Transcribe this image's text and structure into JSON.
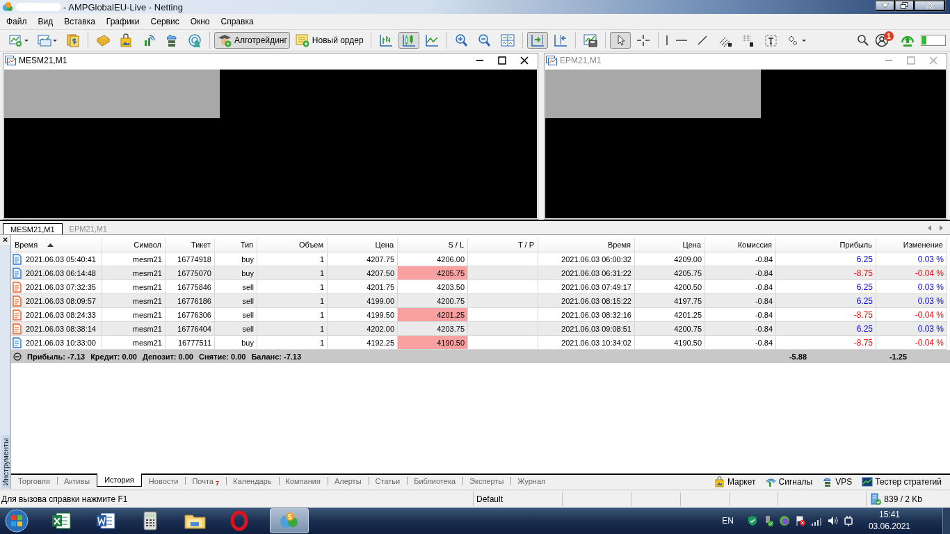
{
  "window": {
    "title": "- AMPGlobalEU-Live - Netting"
  },
  "menu": [
    "Файл",
    "Вид",
    "Вставка",
    "Графики",
    "Сервис",
    "Окно",
    "Справка"
  ],
  "toolbar": [
    {
      "kind": "icon",
      "pressed": false
    },
    {
      "kind": "icon",
      "pressed": false
    },
    {
      "kind": "icon",
      "pressed": false
    },
    {
      "kind": "separator"
    },
    {
      "kind": "icon",
      "pressed": false
    },
    {
      "kind": "icon",
      "pressed": false
    },
    {
      "kind": "icon",
      "pressed": false
    },
    {
      "kind": "icon",
      "pressed": false
    },
    {
      "kind": "icon",
      "pressed": false
    },
    {
      "kind": "separator"
    },
    {
      "kind": "text",
      "label": "Алготрейдинг",
      "pressed": true
    },
    {
      "kind": "text",
      "label": "Новый ордер",
      "pressed": false
    },
    {
      "kind": "separator"
    },
    {
      "kind": "icon",
      "pressed": false
    },
    {
      "kind": "icon",
      "pressed": true
    },
    {
      "kind": "icon",
      "pressed": false
    },
    {
      "kind": "separator"
    },
    {
      "kind": "icon",
      "pressed": false
    },
    {
      "kind": "icon",
      "pressed": false
    },
    {
      "kind": "icon",
      "pressed": false
    },
    {
      "kind": "separator"
    },
    {
      "kind": "icon",
      "pressed": true
    },
    {
      "kind": "icon",
      "pressed": false
    },
    {
      "kind": "separator"
    },
    {
      "kind": "icon",
      "pressed": false
    },
    {
      "kind": "separator"
    },
    {
      "kind": "icon",
      "pressed": true
    },
    {
      "kind": "icon",
      "pressed": false
    },
    {
      "kind": "separator"
    },
    {
      "kind": "icon",
      "pressed": false
    },
    {
      "kind": "icon",
      "pressed": false
    },
    {
      "kind": "icon",
      "pressed": false
    },
    {
      "kind": "icon",
      "pressed": false
    },
    {
      "kind": "icon",
      "pressed": false
    },
    {
      "kind": "icon",
      "pressed": false
    },
    {
      "kind": "icon",
      "pressed": false
    }
  ],
  "notifications_badge": "1",
  "charts": [
    {
      "title": "MESM21,M1",
      "active": true
    },
    {
      "title": "EPM21,M1",
      "active": false
    }
  ],
  "chart_tabs": [
    {
      "label": "MESM21,M1",
      "selected": true
    },
    {
      "label": "EPM21,M1",
      "selected": false
    }
  ],
  "side_panel": {
    "label": "Инструменты",
    "close": "×"
  },
  "table": {
    "columns": [
      {
        "label": "Время",
        "sorted": true
      },
      {
        "label": "Символ",
        "sorted": false
      },
      {
        "label": "Тикет",
        "sorted": false
      },
      {
        "label": "Тип",
        "sorted": false
      },
      {
        "label": "Объем",
        "sorted": false
      },
      {
        "label": "Цена",
        "sorted": false
      },
      {
        "label": "S / L",
        "sorted": false
      },
      {
        "label": "T / P",
        "sorted": false
      },
      {
        "label": "Время",
        "sorted": false
      },
      {
        "label": "Цена",
        "sorted": false
      },
      {
        "label": "Комиссия",
        "sorted": false
      },
      {
        "label": "Прибыль",
        "sorted": false
      },
      {
        "label": "Изменение",
        "sorted": false
      }
    ],
    "rows": [
      {
        "kind": "buy",
        "open_time": "2021.06.03 05:40:41",
        "symbol": "mesm21",
        "ticket": "16774918",
        "type": "buy",
        "volume": "1",
        "open_price": "4207.75",
        "sl": "4206.00",
        "sl_highlight": false,
        "close_time": "2021.06.03 06:00:32",
        "close_price": "4209.00",
        "commission": "-0.84",
        "profit": "6.25",
        "change": "0.03 %",
        "color": "#0000ff"
      },
      {
        "kind": "buy",
        "open_time": "2021.06.03 06:14:48",
        "symbol": "mesm21",
        "ticket": "16775070",
        "type": "buy",
        "volume": "1",
        "open_price": "4207.50",
        "sl": "4205.75",
        "sl_highlight": true,
        "close_time": "2021.06.03 06:31:22",
        "close_price": "4205.75",
        "commission": "-0.84",
        "profit": "-8.75",
        "change": "-0.04 %",
        "color": "#ff0000"
      },
      {
        "kind": "sell",
        "open_time": "2021.06.03 07:32:35",
        "symbol": "mesm21",
        "ticket": "16775846",
        "type": "sell",
        "volume": "1",
        "open_price": "4201.75",
        "sl": "4203.50",
        "sl_highlight": false,
        "close_time": "2021.06.03 07:49:17",
        "close_price": "4200.50",
        "commission": "-0.84",
        "profit": "6.25",
        "change": "0.03 %",
        "color": "#0000ff"
      },
      {
        "kind": "sell",
        "open_time": "2021.06.03 08:09:57",
        "symbol": "mesm21",
        "ticket": "16776186",
        "type": "sell",
        "volume": "1",
        "open_price": "4199.00",
        "sl": "4200.75",
        "sl_highlight": false,
        "close_time": "2021.06.03 08:15:22",
        "close_price": "4197.75",
        "commission": "-0.84",
        "profit": "6.25",
        "change": "0.03 %",
        "color": "#0000ff"
      },
      {
        "kind": "sell",
        "open_time": "2021.06.03 08:24:33",
        "symbol": "mesm21",
        "ticket": "16776306",
        "type": "sell",
        "volume": "1",
        "open_price": "4199.50",
        "sl": "4201.25",
        "sl_highlight": true,
        "close_time": "2021.06.03 08:32:16",
        "close_price": "4201.25",
        "commission": "-0.84",
        "profit": "-8.75",
        "change": "-0.04 %",
        "color": "#ff0000"
      },
      {
        "kind": "sell",
        "open_time": "2021.06.03 08:38:14",
        "symbol": "mesm21",
        "ticket": "16776404",
        "type": "sell",
        "volume": "1",
        "open_price": "4202.00",
        "sl": "4203.75",
        "sl_highlight": false,
        "close_time": "2021.06.03 09:08:51",
        "close_price": "4200.75",
        "commission": "-0.84",
        "profit": "6.25",
        "change": "0.03 %",
        "color": "#0000ff"
      },
      {
        "kind": "buy",
        "open_time": "2021.06.03 10:33:00",
        "symbol": "mesm21",
        "ticket": "16777511",
        "type": "buy",
        "volume": "1",
        "open_price": "4192.25",
        "sl": "4190.50",
        "sl_highlight": true,
        "close_time": "2021.06.03 10:34:02",
        "close_price": "4190.50",
        "commission": "-0.84",
        "profit": "-8.75",
        "change": "-0.04 %",
        "color": "#ff0000"
      }
    ],
    "summary": {
      "items": [
        "Прибыль: -7.13",
        "Кредит: 0.00",
        "Депозит: 0.00",
        "Снятие: 0.00",
        "Баланс: -7.13"
      ],
      "commission": "-5.88",
      "profit": "-1.25"
    }
  },
  "bottom_tabs": [
    {
      "label": "Торговля",
      "selected": false
    },
    {
      "label": "Активы",
      "selected": false
    },
    {
      "label": "История",
      "selected": true
    },
    {
      "label": "Новости",
      "selected": false
    },
    {
      "label": "Почта",
      "selected": false,
      "badge": "7"
    },
    {
      "label": "Календарь",
      "selected": false
    },
    {
      "label": "Компания",
      "selected": false
    },
    {
      "label": "Алерты",
      "selected": false
    },
    {
      "label": "Статьи",
      "selected": false
    },
    {
      "label": "Библиотека",
      "selected": false
    },
    {
      "label": "Эксперты",
      "selected": false
    },
    {
      "label": "Журнал",
      "selected": false
    }
  ],
  "bottom_links": [
    "Маркет",
    "Сигналы",
    "VPS",
    "Тестер стратегий"
  ],
  "status_bar": {
    "help": "Для вызова справки нажмите F1",
    "profile": "Default",
    "traffic": "839 / 2 Kb"
  },
  "taskbar": {
    "apps": [
      {
        "active": false
      },
      {
        "active": false
      },
      {
        "active": false
      },
      {
        "active": false
      },
      {
        "active": false
      },
      {
        "active": true
      }
    ],
    "language": "EN",
    "time": "15:41",
    "date": "03.06.2021"
  }
}
